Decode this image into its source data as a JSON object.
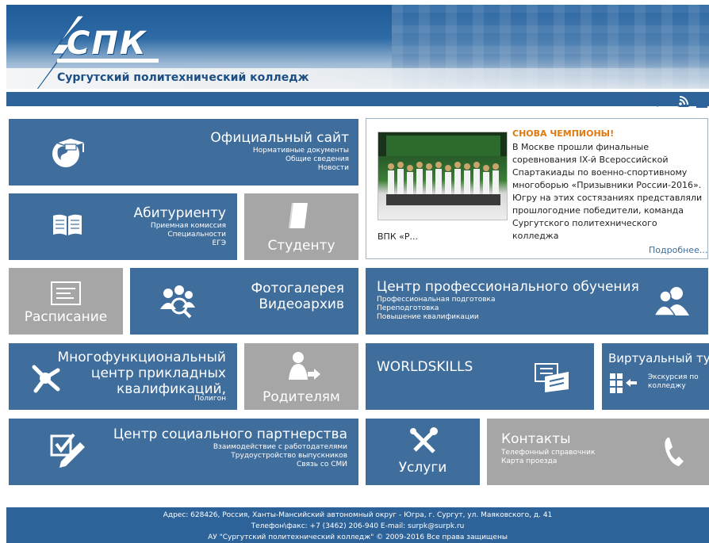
{
  "header": {
    "logo": "СПК",
    "college_name": "Сургутский политехнический  колледж"
  },
  "nav_icons": [
    "key-icon",
    "search-icon",
    "rss-icon",
    "home-icon"
  ],
  "slider": {
    "active": 1,
    "count": 5
  },
  "tiles": {
    "official": {
      "title": "Официальный сайт",
      "links": [
        "Нормативные документы",
        "Общие сведения",
        "Новости"
      ]
    },
    "applicant": {
      "title": "Абитуриенту",
      "links": [
        "Приемная комиссия",
        "Специальности",
        "ЕГЭ"
      ]
    },
    "student": {
      "title": "Студенту"
    },
    "schedule": {
      "title": "Расписание"
    },
    "gallery": {
      "title_line1": "Фотогалерея",
      "title_line2": "Видеоархив"
    },
    "center_training": {
      "title": "Центр профессионального обучения",
      "links": [
        "Профессиональная подготовка",
        "Переподготовка",
        "Повышение квалификации"
      ]
    },
    "mfc": {
      "title_line1": "Многофункциональный",
      "title_line2": "центр прикладных",
      "title_line3": "квалификаций,",
      "link": "Полигон"
    },
    "parents": {
      "title": "Родителям"
    },
    "worldskills": {
      "title": "WORLDSKILLS"
    },
    "virtual": {
      "title": "Виртуальный тур",
      "desc_line1": "Экскурсия по",
      "desc_line2": "колледжу"
    },
    "social": {
      "title": "Центр социального партнерства",
      "links": [
        "Взаимодействие с работодателями",
        "Трудоустройство выпускников",
        "Связь со СМИ"
      ]
    },
    "services": {
      "title": "Услуги"
    },
    "contacts": {
      "title": "Контакты",
      "links": [
        "Телефонный справочник",
        "Карта проезда"
      ]
    }
  },
  "news": {
    "title": "СНОВА ЧЕМПИОНЫ!",
    "body": "В Москве прошли финальные соревнования IX-й Всероссийской Спартакиады по военно-спортивному многоборью  «Призывники России-2016». Югру на этих состязаниях представляли прошлогодние победители, команда Сургутского политехнического колледжа",
    "tail": "ВПК «Р...",
    "more": "Подробнее..."
  },
  "footer": {
    "address": "Адрес: 628426, Россия, Ханты-Мансийский автономный округ - Югра, г. Сургут, ул. Маяковского, д. 41",
    "contacts": "Телефон\\факс: +7 (3462) 206-940     E-mail: surpk@surpk.ru",
    "copyright": "АУ \"Сургутский политехнический колледж\" © 2009-2016 Все права защищены"
  },
  "colors": {
    "tile_blue": "#3f6d9c",
    "tile_grey": "#a6a6a6",
    "header_blue": "#2e6399",
    "news_title": "#e07a10"
  }
}
